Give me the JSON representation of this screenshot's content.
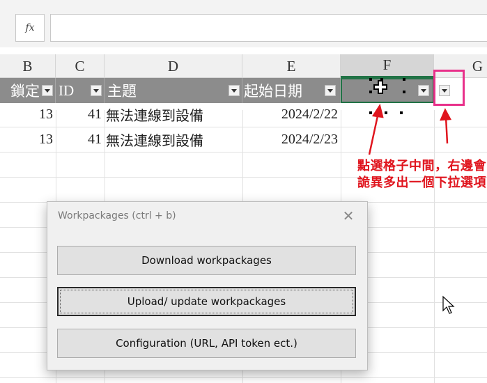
{
  "formula_bar": {
    "fx_label": "fx",
    "value": ""
  },
  "columns": [
    "B",
    "C",
    "D",
    "E",
    "F",
    "G"
  ],
  "table_header": {
    "col_b": "鎖定",
    "col_c": "ID",
    "col_d": "主題",
    "col_e": "起始日期"
  },
  "rows": [
    {
      "b": "13",
      "c": "41",
      "d": "無法連線到設備",
      "e": "2024/2/22"
    },
    {
      "b": "13",
      "c": "41",
      "d": "無法連線到設備",
      "e": "2024/2/23"
    }
  ],
  "annotation": {
    "line1": "點選格子中間，右邊會",
    "line2": "詭異多出一個下拉選項",
    "color": "#e0151e",
    "highlight_color": "#e8308a"
  },
  "dialog": {
    "title": "Workpackages (ctrl + b)",
    "buttons": {
      "download": "Download workpackages",
      "upload": "Upload/ update workpackages",
      "config": "Configuration (URL, API token ect.)"
    }
  },
  "colors": {
    "accent": "#217346",
    "table_header_bg": "#8c8c8c"
  }
}
